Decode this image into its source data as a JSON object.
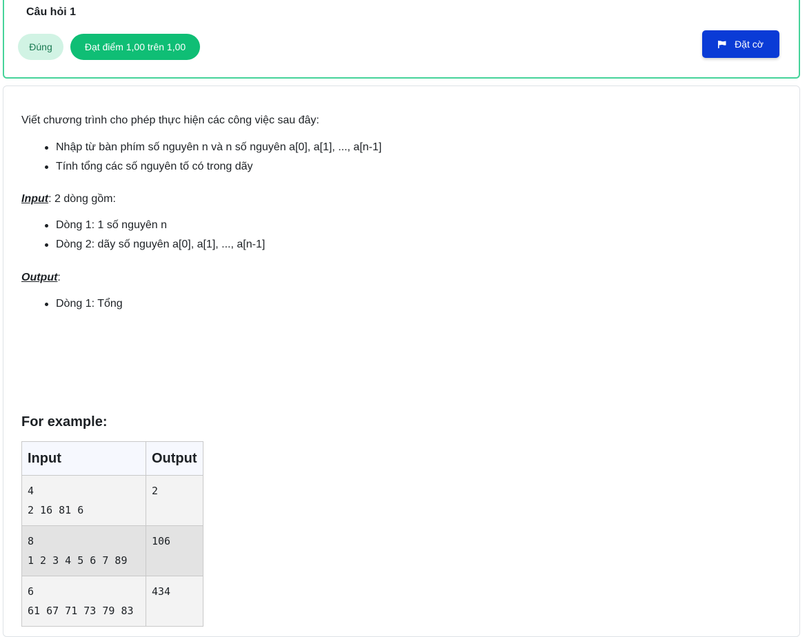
{
  "question": {
    "title": "Câu hỏi 1",
    "status_badge": "Đúng",
    "grade_badge": "Đạt điểm 1,00 trên 1,00",
    "flag_button": "Đặt cờ"
  },
  "content": {
    "intro": "Viết chương trình cho phép thực hiện các công việc sau đây:",
    "tasks": [
      "Nhập từ bàn phím số nguyên n và n số nguyên a[0], a[1], ..., a[n-1]",
      "Tính tổng các số nguyên tố có trong dãy"
    ],
    "input_label": "Input",
    "input_desc": ": 2 dòng gồm:",
    "input_items": [
      "Dòng 1: 1 số nguyên n",
      "Dòng 2: dãy số nguyên a[0], a[1], ..., a[n-1]"
    ],
    "output_label": "Output",
    "output_desc": ":",
    "output_items": [
      "Dòng 1: Tổng"
    ]
  },
  "example": {
    "heading": "For example:",
    "headers": [
      "Input",
      "Output"
    ],
    "rows": [
      {
        "input": "4\n2 16 81 6",
        "output": "2"
      },
      {
        "input": "8\n1 2 3 4 5 6 7 89",
        "output": "106"
      },
      {
        "input": "6\n61 67 71 73 79 83",
        "output": "434"
      }
    ]
  },
  "colors": {
    "correct_border": "#46d39a",
    "grade_badge_bg": "#0fbe75",
    "flag_button_bg": "#0a3bd6"
  }
}
